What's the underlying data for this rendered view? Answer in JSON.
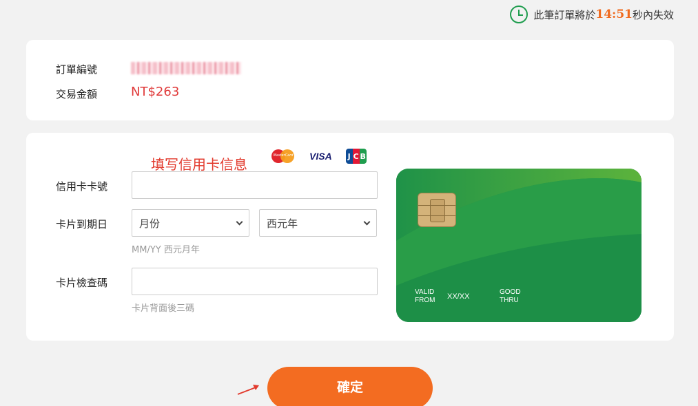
{
  "timer": {
    "prefix": "此筆訂單將於",
    "countdown": "14:51",
    "suffix": "秒內失效"
  },
  "order": {
    "number_label": "訂單編號",
    "number_value": "0 · · · · · · · · · 26",
    "amount_label": "交易金額",
    "amount_value": "NT$263"
  },
  "form": {
    "annotation": "填写信用卡信息",
    "brands": [
      "MasterCard",
      "VISA",
      "JCB"
    ],
    "card_number_label": "信用卡卡號",
    "expiry_label": "卡片到期日",
    "month_select": "月份",
    "year_select": "西元年",
    "expiry_hint": "MM/YY 西元月年",
    "cvv_label": "卡片檢查碼",
    "cvv_hint": "卡片背面後三碼"
  },
  "card_visual": {
    "valid_from": "VALID\nFROM",
    "expiry": "XX/XX",
    "good_thru": "GOOD\nTHRU"
  },
  "confirm_button": "確定",
  "colors": {
    "accent": "#f36c21",
    "alert": "#e03a3a",
    "card_green": "#1d8f47",
    "clock_green": "#1f9d4e"
  }
}
